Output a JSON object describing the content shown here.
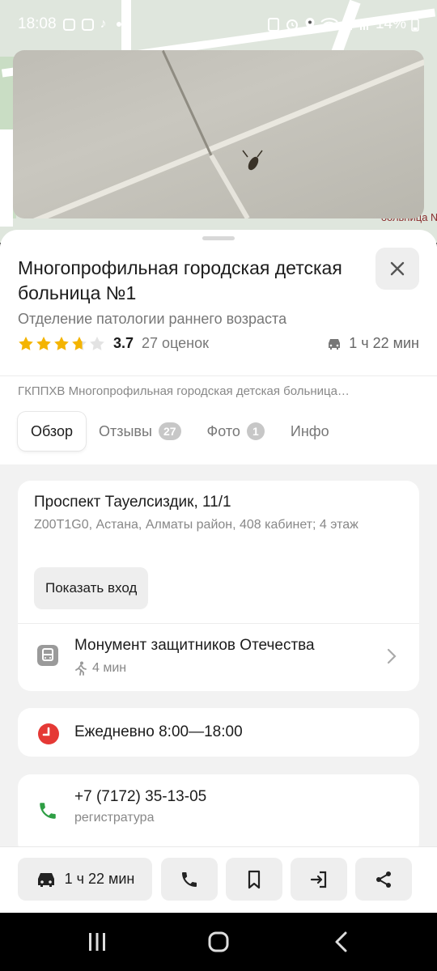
{
  "status_bar": {
    "time": "18:08",
    "battery": "14%"
  },
  "map": {
    "label_fragment": "больница №"
  },
  "place": {
    "title": "Многопрофильная городская детская больница №1",
    "subtitle": "Отделение патологии раннего возраста",
    "rating": "3.7",
    "rating_value": 3.7,
    "rating_count": "27 оценок",
    "travel_time": "1 ч 22 мин",
    "organization": "ГКППХВ Многопрофильная городская детская больница…"
  },
  "tabs": [
    {
      "label": "Обзор",
      "badge": null,
      "active": true
    },
    {
      "label": "Отзывы",
      "badge": "27",
      "active": false
    },
    {
      "label": "Фото",
      "badge": "1",
      "active": false
    },
    {
      "label": "Инфо",
      "badge": null,
      "active": false
    }
  ],
  "address": {
    "main": "Проспект Тауелсиздик, 11/1",
    "details": "Z00T1G0, Астана, Алматы район, 408 кабинет; 4 этаж",
    "entrance_button": "Показать вход"
  },
  "transit": {
    "stop_name": "Монумент защитников Отечества",
    "walk_time": "4 мин"
  },
  "hours": {
    "text": "Ежедневно 8:00—18:00"
  },
  "phone": {
    "number": "+7 (7172) 35-13-05",
    "label": "регистратура"
  },
  "actions": {
    "route_label": "1 ч 22 мин"
  },
  "colors": {
    "star": "#f4b400",
    "hours_icon": "#e53935",
    "phone_icon": "#2e9e44"
  }
}
